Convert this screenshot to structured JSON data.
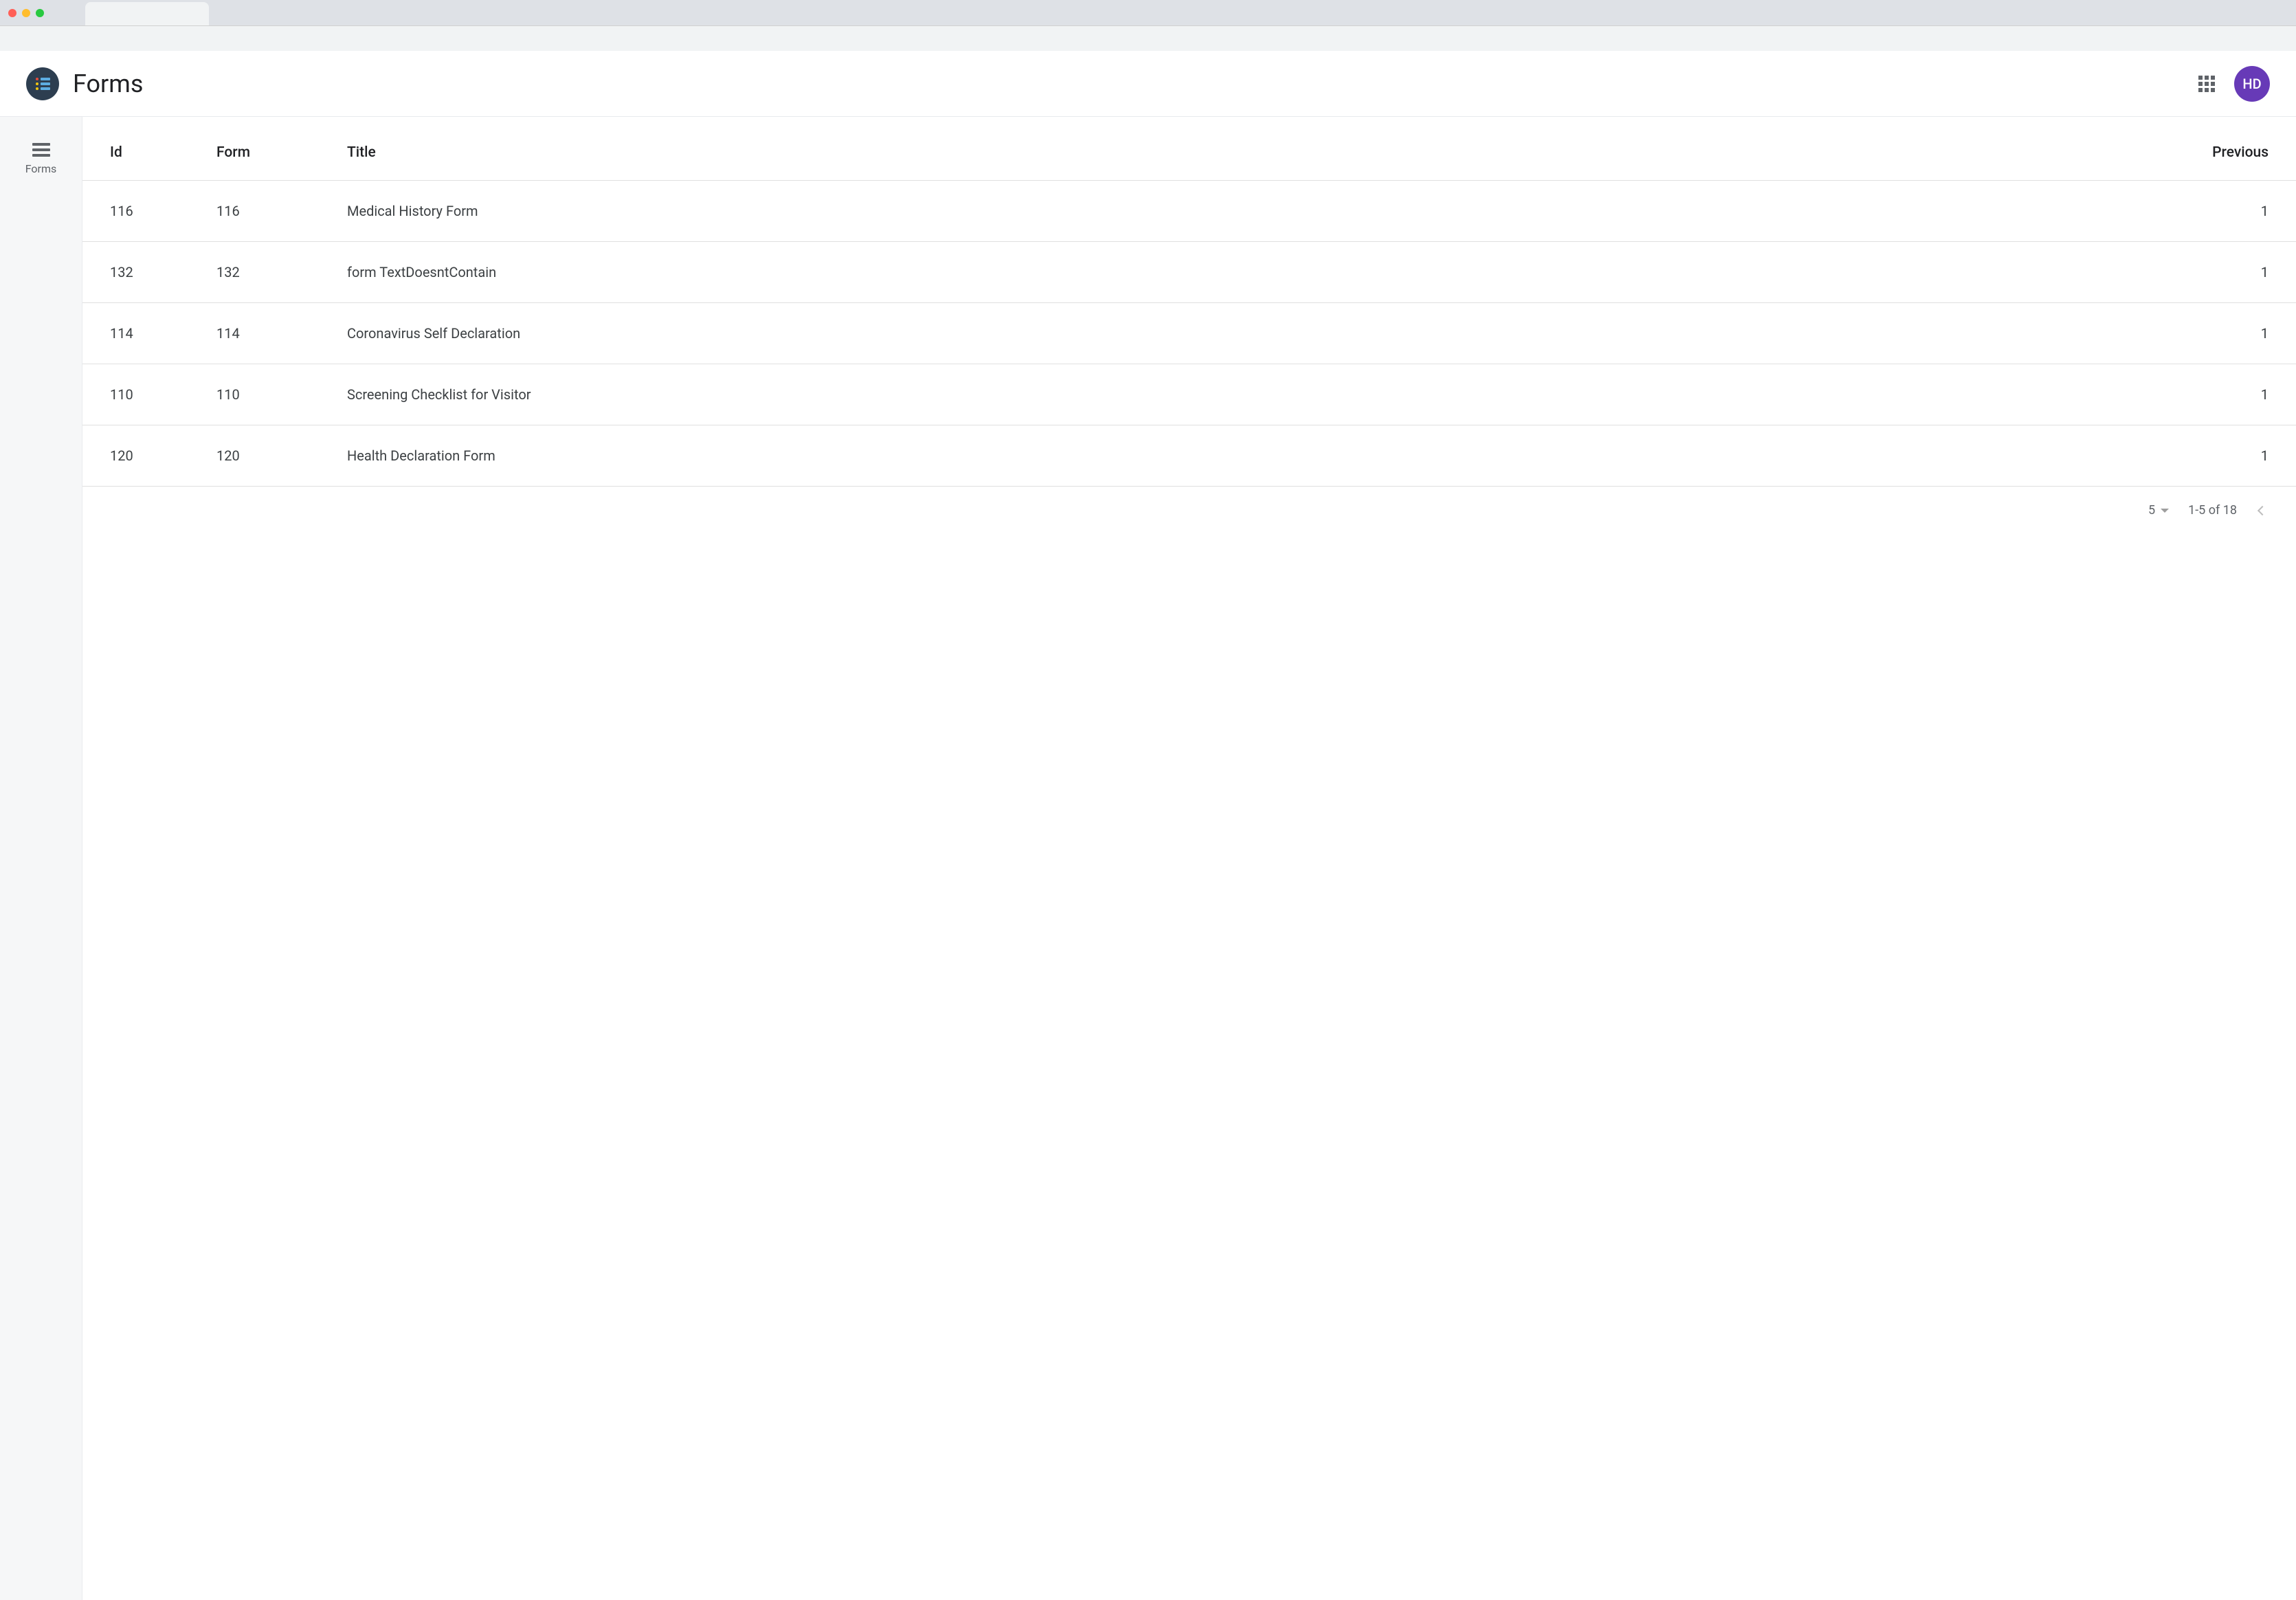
{
  "header": {
    "title": "Forms",
    "avatar_initials": "HD"
  },
  "sidebar": {
    "items": [
      {
        "label": "Forms"
      }
    ]
  },
  "table": {
    "columns": {
      "id": "Id",
      "form": "Form",
      "title": "Title",
      "previous": "Previous"
    },
    "rows": [
      {
        "id": "116",
        "form": "116",
        "title": "Medical History Form",
        "previous": "1"
      },
      {
        "id": "132",
        "form": "132",
        "title": "form TextDoesntContain",
        "previous": "1"
      },
      {
        "id": "114",
        "form": "114",
        "title": "Coronavirus Self Declaration",
        "previous": "1"
      },
      {
        "id": "110",
        "form": "110",
        "title": "Screening Checklist for Visitor",
        "previous": "1"
      },
      {
        "id": "120",
        "form": "120",
        "title": "Health Declaration Form",
        "previous": "1"
      }
    ]
  },
  "pagination": {
    "page_size": "5",
    "range": "1-5 of 18"
  }
}
